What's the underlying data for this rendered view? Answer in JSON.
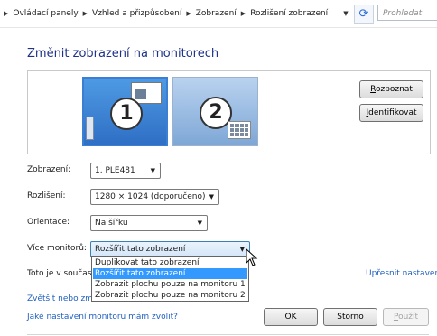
{
  "address_bar": {
    "crumbs": [
      "Ovládací panely",
      "Vzhled a přizpůsobení",
      "Zobrazení",
      "Rozlišení zobrazení"
    ],
    "search_placeholder": "Prohledat"
  },
  "page": {
    "title": "Změnit zobrazení na monitorech"
  },
  "preview": {
    "monitor1_number": "1",
    "monitor2_number": "2",
    "detect_label": "Rozpoznat",
    "identify_label": "Identifikovat"
  },
  "settings": {
    "display_label": "Zobrazení:",
    "display_value": "1. PLE481",
    "resolution_label": "Rozlišení:",
    "resolution_value": "1280 × 1024 (doporučeno)",
    "orientation_label": "Orientace:",
    "orientation_value": "Na šířku",
    "multiple_label": "Více monitorů:",
    "multiple_value": "Rozšířit tato zobrazení",
    "current_text": "Toto je v současnosti",
    "advanced_link": "Upřesnit nastavení"
  },
  "dropdown": {
    "options": [
      "Duplikovat tato zobrazení",
      "Rozšířit tato zobrazení",
      "Zobrazit plochu pouze na monitoru 1",
      "Zobrazit plochu pouze na monitoru 2"
    ],
    "selected_index": 1
  },
  "links": {
    "enlarge": "Zvětšit nebo zme",
    "which_settings": "Jaké nastavení monitoru mám zvolit?"
  },
  "buttons": {
    "ok": "OK",
    "cancel": "Storno",
    "apply": "Použít"
  },
  "colors": {
    "title": "#1e3287",
    "link": "#1f5fbf",
    "selection": "#3399ff",
    "monitor_active": "#3a7fd3"
  }
}
